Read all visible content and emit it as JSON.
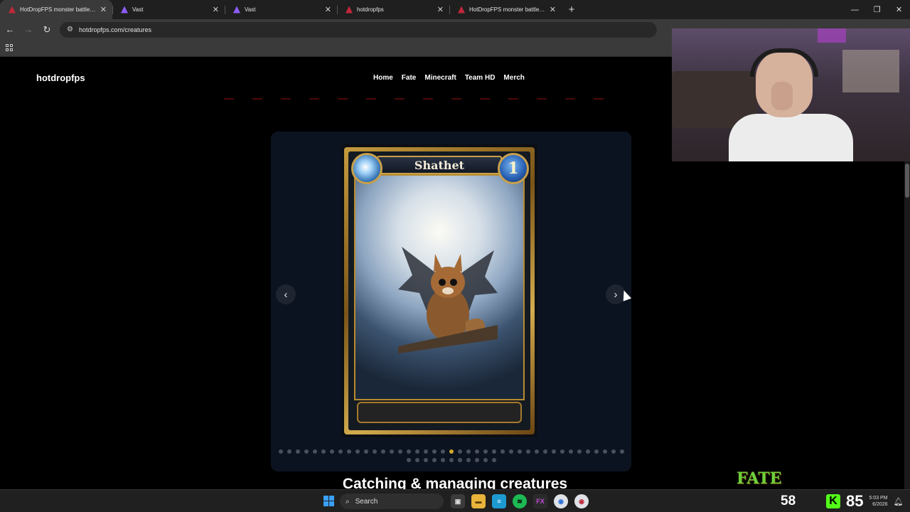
{
  "browser": {
    "tabs": [
      {
        "title": "HotDropFPS monster battle sty",
        "active": true,
        "favicon_color": "#c0283a"
      },
      {
        "title": "Vast",
        "active": false,
        "favicon_color": "#8b5cf6"
      },
      {
        "title": "Vast",
        "active": false,
        "favicon_color": "#8b5cf6"
      },
      {
        "title": "hotdropfps",
        "active": false,
        "favicon_color": "#c0283a"
      },
      {
        "title": "HotDropFPS monster battle sty",
        "active": false,
        "favicon_color": "#c0283a"
      }
    ],
    "new_tab": "+",
    "address": "hotdropfps.com/creatures",
    "window_controls": {
      "minimize": "—",
      "restore": "❐",
      "close": "✕"
    }
  },
  "site": {
    "brand": "hotdropfps",
    "nav": [
      "Home",
      "Fate",
      "Minecraft",
      "Team HD",
      "Merch"
    ]
  },
  "carousel": {
    "prev": "‹",
    "next": "›",
    "total_dots": 52,
    "active_dot": 20,
    "card": {
      "name": "Shathet",
      "cost": "1",
      "element": "water-swirl-icon"
    }
  },
  "section": {
    "heading": "Catching & managing creatures"
  },
  "taskbar": {
    "search_label": "Search",
    "overlay_logo": "FATE",
    "overlay_number": "58",
    "big_number": "85",
    "clock_time": "5:03 PM",
    "clock_date": "6/2026"
  },
  "colors": {
    "accent_gold": "#d4a72a",
    "panel": "#0c1320",
    "kick_green": "#53fc18"
  }
}
